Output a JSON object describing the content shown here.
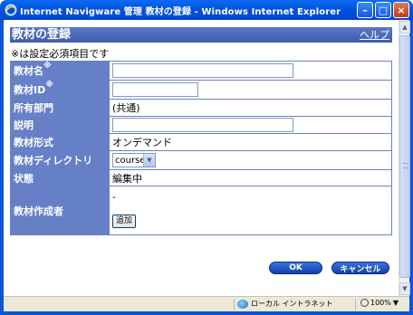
{
  "window": {
    "title": "Internet Navigware 管理 教材の登録 - Windows Internet Explorer"
  },
  "header": {
    "title": "教材の登録",
    "help_label": "ヘルプ"
  },
  "required_note": {
    "mark": "※",
    "text": "は設定必須項目です"
  },
  "form": {
    "name_label": "教材名",
    "id_label": "教材ID",
    "required_mark": "※",
    "dept_label": "所有部門",
    "dept_value": "(共通)",
    "desc_label": "説明",
    "format_label": "教材形式",
    "format_value": "オンデマンド",
    "directory_label": "教材ディレクトリ",
    "directory_value": "course",
    "status_label": "状態",
    "status_value": "編集中",
    "creator_label": "教材作成者",
    "creator_value": "-",
    "add_label": "追加"
  },
  "buttons": {
    "ok_label": "OK",
    "cancel_label": "キャンセル"
  },
  "statusbar": {
    "zone_label": "ローカル イントラネット",
    "zoom_label": "100%"
  },
  "colors": {
    "titlebar": "#0253e0",
    "header_bar": "#4a66b7",
    "label_cell": "#6680c8",
    "button": "#1f4fc2"
  }
}
